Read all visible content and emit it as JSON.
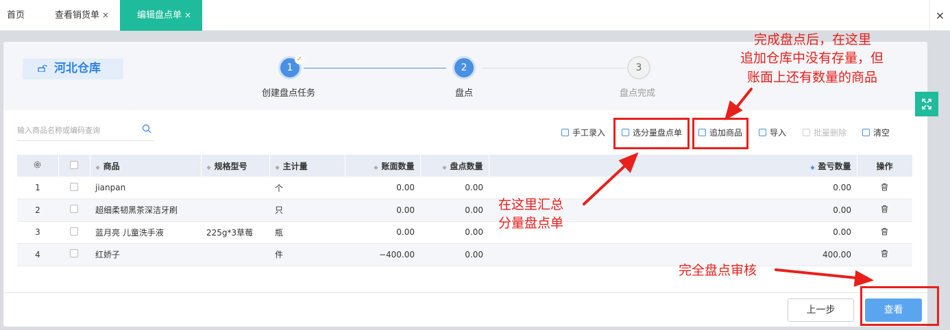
{
  "tabs": [
    {
      "label": "首页",
      "closable": false
    },
    {
      "label": "查看销货单",
      "closable": true
    },
    {
      "label": "编辑盘点单",
      "closable": true,
      "active": true
    }
  ],
  "tab_close_glyph": "×",
  "window_close_glyph": "×",
  "warehouse": "河北仓库",
  "steps": [
    {
      "number": "1",
      "label": "创建盘点任务",
      "state": "done"
    },
    {
      "number": "2",
      "label": "盘点",
      "state": "current"
    },
    {
      "number": "3",
      "label": "盘点完成",
      "state": "todo"
    }
  ],
  "search": {
    "placeholder": "输入商品名称或编码查询"
  },
  "toolbar": {
    "manual_entry": "手工录入",
    "select_sub_sheets": "选分量盘点单",
    "add_product": "追加商品",
    "import": "导入",
    "batch_delete": "批量删除",
    "clear": "清空"
  },
  "table": {
    "columns": [
      "商品",
      "规格型号",
      "主计量",
      "账面数量",
      "盘点数量",
      "盈亏数量",
      "操作"
    ],
    "rows": [
      {
        "no": "1",
        "name": "jianpan",
        "spec": "",
        "unit": "个",
        "book_qty": "0.00",
        "count_qty": "0.00",
        "diff_qty": "0.00"
      },
      {
        "no": "2",
        "name": "超细柔韧黑茶深洁牙刷",
        "spec": "",
        "unit": "只",
        "book_qty": "0.00",
        "count_qty": "0.00",
        "diff_qty": "0.00"
      },
      {
        "no": "3",
        "name": "蓝月亮 儿童洗手液",
        "spec": "225g*3草莓",
        "unit": "瓶",
        "book_qty": "0.00",
        "count_qty": "0.00",
        "diff_qty": "0.00"
      },
      {
        "no": "4",
        "name": "红娇子",
        "spec": "",
        "unit": "件",
        "book_qty": "−400.00",
        "count_qty": "0.00",
        "diff_qty": "400.00"
      }
    ]
  },
  "buttons": {
    "prev": "上一步",
    "view": "查看"
  },
  "annotations": {
    "top_right": [
      "完成盘点后，在这里",
      "追加仓库中没有存量，但",
      "账面上还有数量的商品"
    ],
    "middle": [
      "在这里汇总",
      "分量盘点单"
    ],
    "bottom": "完全盘点审核"
  },
  "colors": {
    "accent_teal": "#1ebc9c",
    "step_blue": "#4a90e2",
    "annotation_red": "#e8201c",
    "primary_button": "#5ba5f0"
  }
}
